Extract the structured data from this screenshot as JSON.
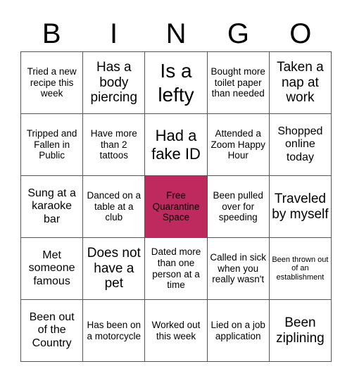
{
  "header": {
    "letters": [
      "B",
      "I",
      "N",
      "G",
      "O"
    ]
  },
  "free_space_color": "#bf2a5e",
  "cells": [
    [
      "Tried a new recipe this week",
      "Has a body piercing",
      "Is a lefty",
      "Bought more toilet paper than needed",
      "Taken a nap at work"
    ],
    [
      "Tripped and Fallen in Public",
      "Have more than 2 tattoos",
      "Had a fake ID",
      "Attended a Zoom Happy Hour",
      "Shopped online today"
    ],
    [
      "Sung at a karaoke bar",
      "Danced on a table at a club",
      "Free Quarantine Space",
      "Been pulled over for speeding",
      "Traveled by myself"
    ],
    [
      "Met someone famous",
      "Does not have a pet",
      "Dated more than one person at a time",
      "Called in sick when you really wasn't",
      "Been thrown out of an establishment"
    ],
    [
      "Been out of the Country",
      "Has been on a motorcycle",
      "Worked out this week",
      "Lied on a job application",
      "Been ziplining"
    ]
  ]
}
